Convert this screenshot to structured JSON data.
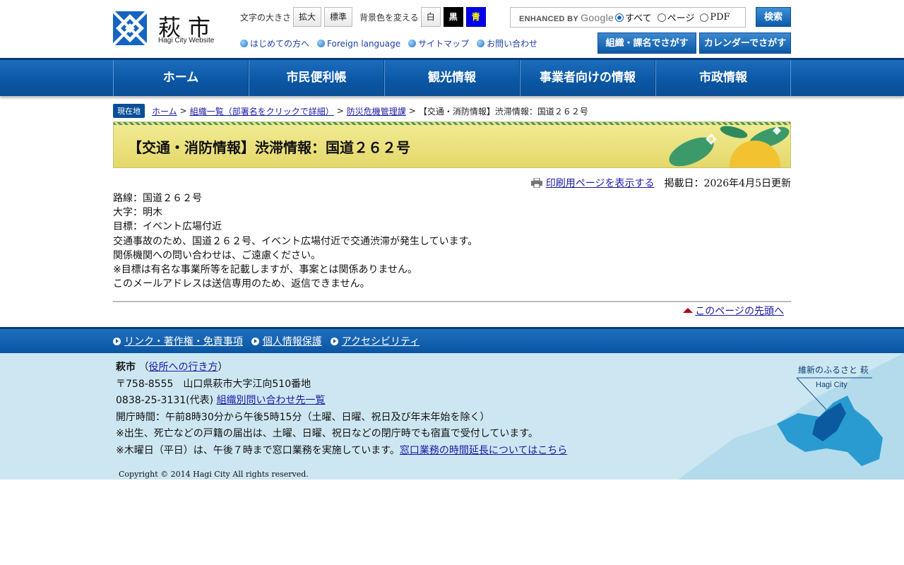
{
  "site": {
    "name": "萩市",
    "subtitle": "Hagi City Website"
  },
  "tools": {
    "font_size_label": "文字の大きさ",
    "enlarge": "拡大",
    "standard": "標準",
    "bg_label": "背景色を変える",
    "white": "白",
    "black": "黒",
    "blue": "青"
  },
  "sublinks": [
    "はじめての方へ",
    "Foreign language",
    "サイトマップ",
    "お問い合わせ"
  ],
  "search": {
    "enhanced_prefix": "ENHANCED BY",
    "google": "Google",
    "options": [
      "すべて",
      "ページ",
      "PDF"
    ],
    "selected": "すべて",
    "button": "検索"
  },
  "bigbuttons": [
    "組織・課名でさがす",
    "カレンダーでさがす"
  ],
  "nav": [
    "ホーム",
    "市民便利帳",
    "観光情報",
    "事業者向けの情報",
    "市政情報"
  ],
  "breadcrumb": {
    "here": "現在地",
    "links": [
      "ホーム",
      "組織一覧（部署名をクリックで詳細）",
      "防災危機管理課"
    ],
    "current": "【交通・消防情報】渋滞情報：国道２６２号"
  },
  "page": {
    "title": "【交通・消防情報】渋滞情報：国道２６２号",
    "print_link": "印刷用ページを表示する",
    "date": "掲載日：2026年4月5日更新",
    "lines": [
      "路線：国道２６２号",
      "大字：明木",
      "目標：イベント広場付近",
      "交通事故のため、国道２６２号、イベント広場付近で交通渋滞が発生しています。",
      "関係機関への問い合わせは、ご遠慮ください。",
      "※目標は有名な事業所等を記載しますが、事案とは関係ありません。",
      "このメールアドレスは送信専用のため、返信できません。"
    ],
    "page_top": "このページの先頭へ"
  },
  "footer_nav": [
    "リンク・著作権・免責事項",
    "個人情報保護",
    "アクセシビリティ"
  ],
  "footer": {
    "org": "萩市",
    "access_open": "（",
    "access_link": "役所への行き方",
    "access_close": "）",
    "address": "〒758-8555　山口県萩市大字江向510番地",
    "phone": "0838-25-3131(代表)",
    "contact_link": "組織別問い合わせ先一覧",
    "hours": "開庁時間：午前8時30分から午後5時15分（土曜、日曜、祝日及び年末年始を除く）",
    "note1": "※出生、死亡などの戸籍の届出は、土曜、日曜、祝日などの閉庁時でも宿直で受付しています。",
    "note2": "※木曜日（平日）は、午後７時まで窓口業務を実施しています。",
    "extension_link": "窓口業務の時間延長についてはこちら",
    "copyright": "Copyright © 2014 Hagi City All rights reserved.",
    "map_caption": "維新のふるさと 萩",
    "map_sub": "Hagi City"
  },
  "colors": {
    "brand_blue": "#0a56a3",
    "title_yellow": "#e4d86a",
    "footer_bg": "#cde7f2"
  }
}
